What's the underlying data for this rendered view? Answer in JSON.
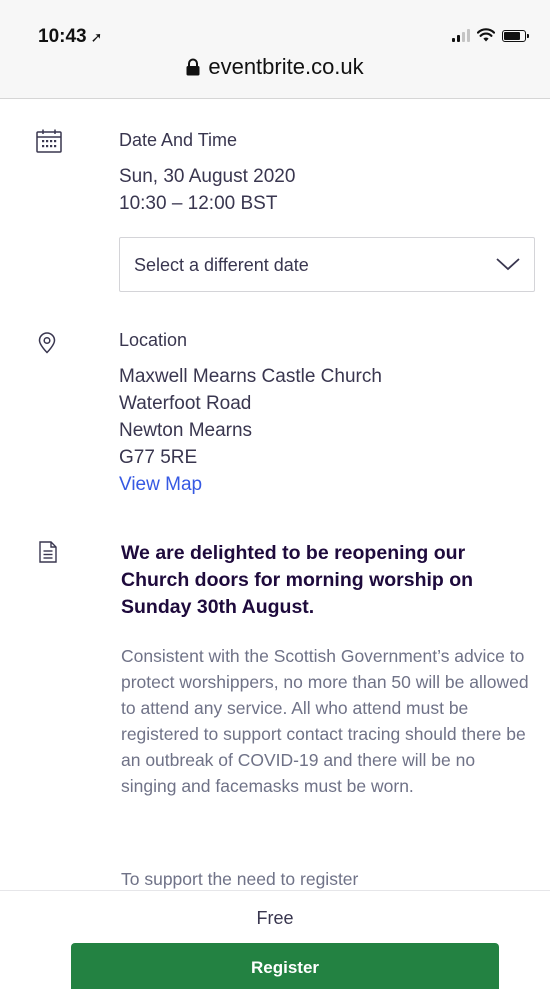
{
  "status_bar": {
    "time": "10:43",
    "location_arrow": "➚"
  },
  "browser": {
    "url": "eventbrite.co.uk"
  },
  "date_time": {
    "heading": "Date And Time",
    "date": "Sun, 30 August 2020",
    "time_range": "10:30 – 12:00 BST",
    "select_label": "Select a different date"
  },
  "location": {
    "heading": "Location",
    "address": [
      "Maxwell Mearns Castle Church",
      "Waterfoot Road",
      "Newton Mearns",
      "G77 5RE"
    ],
    "map_link": "View Map"
  },
  "description": {
    "title": "We are delighted to be reopening our Church doors for morning worship on Sunday 30th August.",
    "body": "Consistent with the Scottish Government’s advice to protect worshippers, no more than 50 will be allowed to attend any service. All who attend must be registered to support contact tracing should there be an outbreak of COVID-19 and there will be no singing and facemasks must be worn.",
    "body_cutoff": "To support the need to register"
  },
  "footer": {
    "price": "Free",
    "register_label": "Register"
  },
  "colors": {
    "register_button": "#238242",
    "link": "#3659e3",
    "heading": "#1e0a3c"
  }
}
